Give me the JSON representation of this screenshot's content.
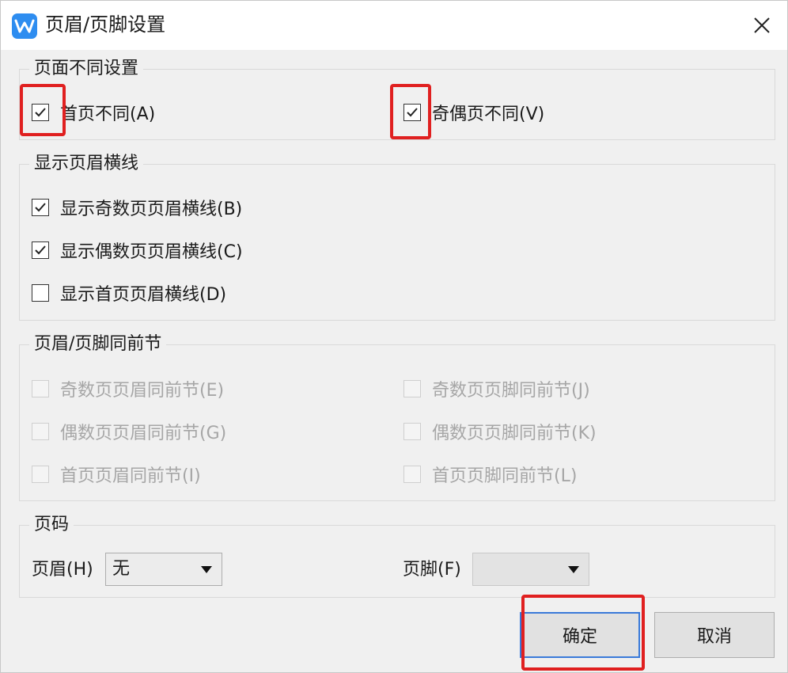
{
  "title": "页眉/页脚设置",
  "icons": {
    "app": "wps-writer-icon",
    "close": "close-icon",
    "dropdown": "chevron-down-icon",
    "check": "checkmark-icon"
  },
  "colors": {
    "highlight": "#e02020",
    "app_icon": "#2e8df0",
    "primary_border": "#3a7ad9"
  },
  "page_setting": {
    "title": "页面不同设置",
    "first_page_diff": {
      "label": "首页不同(A)",
      "checked": true
    },
    "odd_even_diff": {
      "label": "奇偶页不同(V)",
      "checked": true
    }
  },
  "header_lines": {
    "title": "显示页眉横线",
    "odd": {
      "label": "显示奇数页页眉横线(B)",
      "checked": true
    },
    "even": {
      "label": "显示偶数页页眉横线(C)",
      "checked": true
    },
    "first": {
      "label": "显示首页页眉横线(D)",
      "checked": false
    }
  },
  "same_as_prev": {
    "title": "页眉/页脚同前节",
    "odd_header": {
      "label": "奇数页页眉同前节(E)",
      "checked": false,
      "disabled": true
    },
    "odd_footer": {
      "label": "奇数页页脚同前节(J)",
      "checked": false,
      "disabled": true
    },
    "even_header": {
      "label": "偶数页页眉同前节(G)",
      "checked": false,
      "disabled": true
    },
    "even_footer": {
      "label": "偶数页页脚同前节(K)",
      "checked": false,
      "disabled": true
    },
    "first_header": {
      "label": "首页页眉同前节(I)",
      "checked": false,
      "disabled": true
    },
    "first_footer": {
      "label": "首页页脚同前节(L)",
      "checked": false,
      "disabled": true
    }
  },
  "page_number": {
    "title": "页码",
    "header_label": "页眉(H)",
    "header_value": "无",
    "footer_label": "页脚(F)",
    "footer_value": ""
  },
  "buttons": {
    "ok": "确定",
    "cancel": "取消"
  }
}
